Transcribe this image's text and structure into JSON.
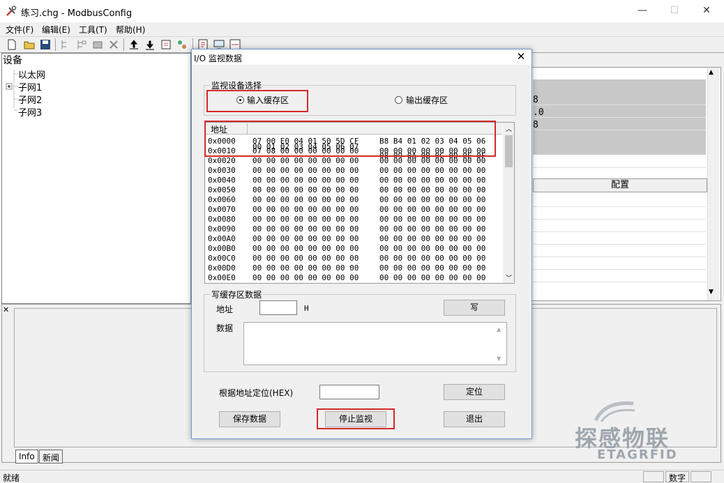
{
  "app": {
    "title": "练习.chg - ModbusConfig",
    "window_controls": {
      "minimize": "—",
      "maximize": "☐",
      "close": "✕"
    }
  },
  "menubar": [
    "文件(F)",
    "编辑(E)",
    "工具(T)",
    "帮助(H)"
  ],
  "toolbar_icons": [
    "new-file-icon",
    "open-folder-icon",
    "save-icon",
    "add-node-icon",
    "add-child-icon",
    "properties-icon",
    "delete-icon",
    "upload-icon",
    "download-icon",
    "export-icon",
    "tools-icon",
    "report-icon",
    "monitor-icon",
    "io-icon"
  ],
  "device_tree": {
    "header": "设备",
    "items": [
      {
        "label": "以太网",
        "expandable": false
      },
      {
        "label": "子网1",
        "expandable": true
      },
      {
        "label": "子网2",
        "expandable": false
      },
      {
        "label": "子网3",
        "expandable": false
      }
    ]
  },
  "right_pane": {
    "grey_rows": [
      "8",
      ".0",
      "8"
    ],
    "config_button": "配置"
  },
  "bottom_tabs": [
    "Info",
    "新闻"
  ],
  "status": {
    "left": "就绪",
    "mid": "数字"
  },
  "dialog": {
    "title": "I/O 监视数据",
    "close": "✕",
    "device_select": {
      "legend": "监视设备选择",
      "input_option": "输入缓存区",
      "output_option": "输出缓存区",
      "selected": "input"
    },
    "hex": {
      "header_addr": "地址",
      "header_b1": "00 01 02 03 04 05 06 07",
      "header_b2": "08 09 0A 0B 0C 0D 0E 0F",
      "rows": [
        {
          "addr": "0x0000",
          "b1": "07 00 E0 04 01 50 5D CF",
          "b2": "B8 B4 01 02 03 04 05 06"
        },
        {
          "addr": "0x0010",
          "b1": "07 08 00 00 00 00 00 00",
          "b2": "00 00 00 00 00 00 00 00"
        },
        {
          "addr": "0x0020",
          "b1": "00 00 00 00 00 00 00 00",
          "b2": "00 00 00 00 00 00 00 00"
        },
        {
          "addr": "0x0030",
          "b1": "00 00 00 00 00 00 00 00",
          "b2": "00 00 00 00 00 00 00 00"
        },
        {
          "addr": "0x0040",
          "b1": "00 00 00 00 00 00 00 00",
          "b2": "00 00 00 00 00 00 00 00"
        },
        {
          "addr": "0x0050",
          "b1": "00 00 00 00 00 00 00 00",
          "b2": "00 00 00 00 00 00 00 00"
        },
        {
          "addr": "0x0060",
          "b1": "00 00 00 00 00 00 00 00",
          "b2": "00 00 00 00 00 00 00 00"
        },
        {
          "addr": "0x0070",
          "b1": "00 00 00 00 00 00 00 00",
          "b2": "00 00 00 00 00 00 00 00"
        },
        {
          "addr": "0x0080",
          "b1": "00 00 00 00 00 00 00 00",
          "b2": "00 00 00 00 00 00 00 00"
        },
        {
          "addr": "0x0090",
          "b1": "00 00 00 00 00 00 00 00",
          "b2": "00 00 00 00 00 00 00 00"
        },
        {
          "addr": "0x00A0",
          "b1": "00 00 00 00 00 00 00 00",
          "b2": "00 00 00 00 00 00 00 00"
        },
        {
          "addr": "0x00B0",
          "b1": "00 00 00 00 00 00 00 00",
          "b2": "00 00 00 00 00 00 00 00"
        },
        {
          "addr": "0x00C0",
          "b1": "00 00 00 00 00 00 00 00",
          "b2": "00 00 00 00 00 00 00 00"
        },
        {
          "addr": "0x00D0",
          "b1": "00 00 00 00 00 00 00 00",
          "b2": "00 00 00 00 00 00 00 00"
        },
        {
          "addr": "0x00E0",
          "b1": "00 00 00 00 00 00 00 00",
          "b2": "00 00 00 00 00 00 00 00"
        }
      ]
    },
    "write": {
      "legend": "写缓存区数据",
      "addr_label": "地址",
      "addr_value": "",
      "addr_suffix": "H",
      "write_button": "写",
      "data_label": "数据",
      "data_value": ""
    },
    "locate_label": "根据地址定位(HEX)",
    "locate_value": "",
    "locate_button": "定位",
    "save_button": "保存数据",
    "stop_button": "停止监视",
    "exit_button": "退出"
  },
  "watermark": {
    "line1": "探感物联",
    "line2": "ETAGRFID"
  },
  "colors": {
    "highlight_red": "#d42a2a",
    "dialog_border": "#6c9bd2",
    "watermark": "#9ea6ae"
  }
}
